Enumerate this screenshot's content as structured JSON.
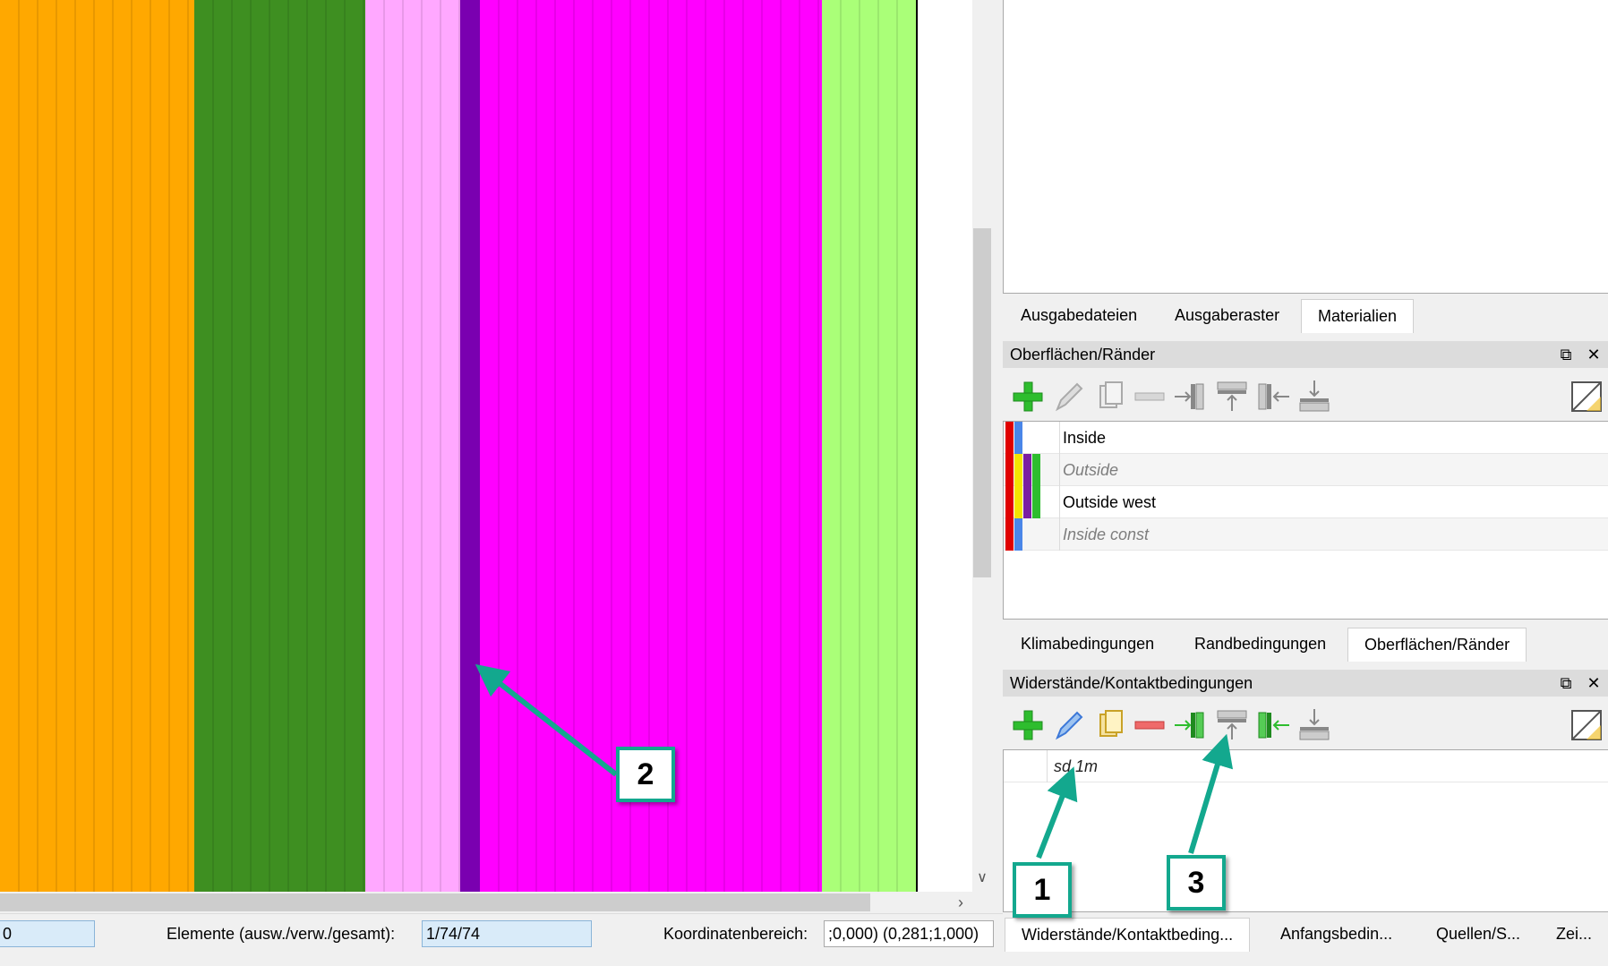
{
  "viewport": {
    "bands": [
      {
        "name": "orange-layer",
        "color": "#ffa800",
        "stripes": true
      },
      {
        "name": "dark-green-layer",
        "color": "#3e8f21",
        "stripes": true
      },
      {
        "name": "light-pink-layer",
        "color": "#ffa8ff",
        "stripes": true
      },
      {
        "name": "purple-interface",
        "color": "#7a00b0",
        "stripes": false
      },
      {
        "name": "magenta-layer",
        "color": "#ff00ff",
        "stripes": true
      },
      {
        "name": "light-green-layer",
        "color": "#aaff78",
        "stripes": true
      }
    ]
  },
  "statusbar": {
    "first_field_value": "0",
    "elements_label": "Elemente (ausw./verw./gesamt):",
    "elements_value": "1/74/74",
    "coords_label": "Koordinatenbereich:",
    "coords_value": ";0,000)  (0,281;1,000)"
  },
  "top_tabs": {
    "items": [
      "Ausgabedateien",
      "Ausgaberaster",
      "Materialien"
    ],
    "active": "Materialien"
  },
  "surfaces_panel": {
    "title": "Oberflächen/Ränder",
    "toolbar": [
      "add-icon",
      "edit-icon",
      "copy-icon",
      "remove-icon",
      "assign-right-icon",
      "assign-top-icon",
      "assign-left-icon",
      "assign-bottom-icon",
      "toggle-view-icon"
    ],
    "rows": [
      {
        "label": "Inside",
        "italic": false,
        "colors": [
          "#e00000",
          "#4a86e8"
        ]
      },
      {
        "label": "Outside",
        "italic": true,
        "colors": [
          "#e00000",
          "#f4e400",
          "#7a1fa2",
          "#2ebd2e"
        ]
      },
      {
        "label": "Outside west",
        "italic": false,
        "colors": [
          "#e00000",
          "#f4e400",
          "#7a1fa2",
          "#2ebd2e"
        ]
      },
      {
        "label": "Inside const",
        "italic": true,
        "colors": [
          "#e00000",
          "#4a86e8"
        ]
      }
    ]
  },
  "middle_tabs": {
    "items": [
      "Klimabedingungen",
      "Randbedingungen",
      "Oberflächen/Ränder"
    ],
    "active": "Oberflächen/Ränder"
  },
  "resistances_panel": {
    "title": "Widerstände/Kontaktbedingungen",
    "toolbar": [
      "add-icon",
      "edit-icon",
      "copy-icon",
      "remove-icon",
      "assign-right-icon",
      "assign-top-icon",
      "assign-left-icon",
      "assign-bottom-icon",
      "toggle-view-icon"
    ],
    "rows": [
      {
        "label": "sd 1m",
        "italic": true
      }
    ]
  },
  "bottom_tabs": {
    "items": [
      "Widerstände/Kontaktbeding...",
      "Anfangsbedin...",
      "Quellen/S...",
      "Zei..."
    ],
    "active": "Widerstände/Kontaktbeding..."
  },
  "callouts": [
    "1",
    "2",
    "3"
  ],
  "accent_color": "#13a88e"
}
